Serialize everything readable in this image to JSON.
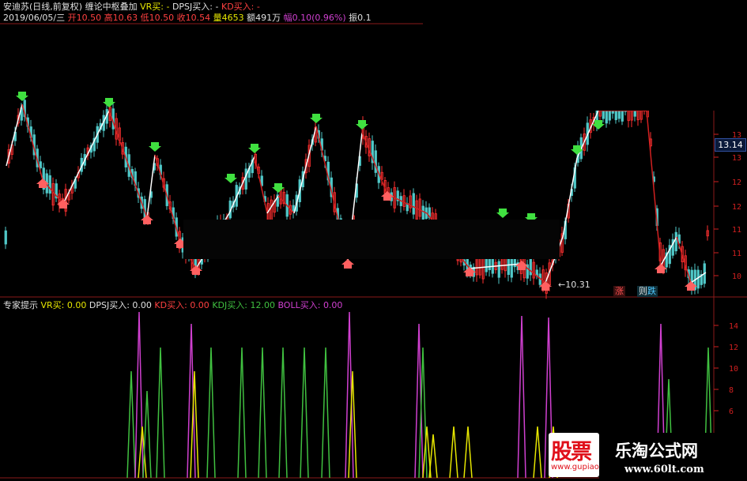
{
  "header": {
    "stock_name": "安迪苏(日线,前复权)",
    "indicator_name": "缠论中枢叠加",
    "vr_label": "VR买:",
    "vr_value": "-",
    "dpsj_label": "DPSJ买入:",
    "dpsj_value": "-",
    "kd_label": "KD买入:",
    "kd_value": "-"
  },
  "quote": {
    "date": "2019/06/05/三",
    "open_label": "开",
    "open": "10.50",
    "high_label": "高",
    "high": "10.63",
    "low_label": "低",
    "low": "10.50",
    "close_label": "收",
    "close": "10.54",
    "volume_label": "量",
    "volume": "4653",
    "amount_label": "额",
    "amount": "491万",
    "change_label": "幅",
    "change": "0.10(0.96%)",
    "amplitude_label": "振",
    "amplitude": "0.1"
  },
  "price_axis": {
    "ticks": [
      "13",
      "13",
      "12",
      "12",
      "11",
      "11",
      "10"
    ],
    "current_price": "13.14"
  },
  "annotations": {
    "low_price": "10.31",
    "marker_rise": "涨",
    "marker_fall": "跌",
    "marker_fall_prefix": "则"
  },
  "sub_panel": {
    "title": "专家提示",
    "vr_label": "VR买:",
    "vr_value": "0.00",
    "dpsj_label": "DPSJ买入:",
    "dpsj_value": "0.00",
    "kd_label": "KD买入:",
    "kd_value": "0.00",
    "kdj_label": "KDJ买入:",
    "kdj_value": "12.00",
    "boll_label": "BOLL买入:",
    "boll_value": "0.00",
    "axis_ticks": [
      "14",
      "12",
      "10",
      "8",
      "6"
    ]
  },
  "watermark": {
    "logo_text": "股票",
    "logo_sub": "www.gupiao.com",
    "site_title": "乐淘公式网",
    "site_url": "www.60lt.com"
  },
  "colors": {
    "background": "#000000",
    "up": "#ff3030",
    "down": "#50c8c8",
    "axis": "#d02020",
    "buy_arrow": "#ff6060",
    "sell_arrow": "#40e040",
    "stroke_line": "#ffffff",
    "center_line": "#d02020",
    "kdj": "#40c040",
    "boll": "#d040d0",
    "vr": "#e6e600"
  }
}
